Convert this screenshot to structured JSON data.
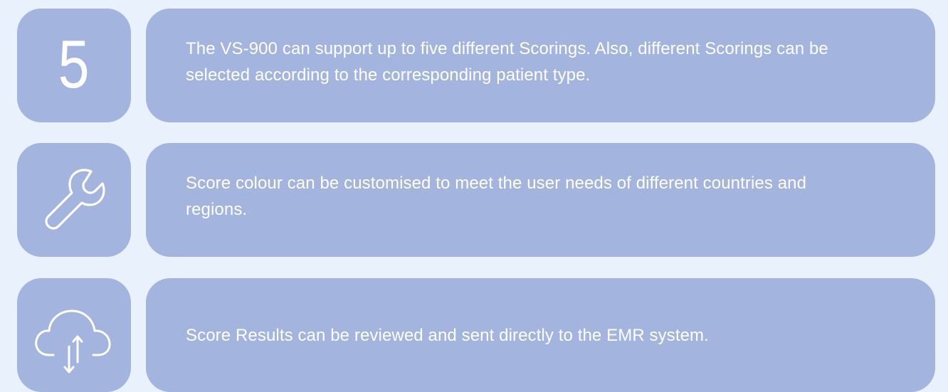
{
  "features": [
    {
      "icon": "number-five-icon",
      "icon_text": "5",
      "text": "The VS-900 can support up to five different Scorings. Also, different Scorings can be selected according to the corresponding patient type."
    },
    {
      "icon": "wrench-icon",
      "text": "Score colour can be customised to meet the user needs of different countries and regions."
    },
    {
      "icon": "cloud-upload-download-icon",
      "text": "Score Results can be reviewed and sent directly to the EMR system."
    }
  ],
  "colors": {
    "background": "#e9f1fd",
    "card": "#a3b4de",
    "text": "#ffffff"
  }
}
